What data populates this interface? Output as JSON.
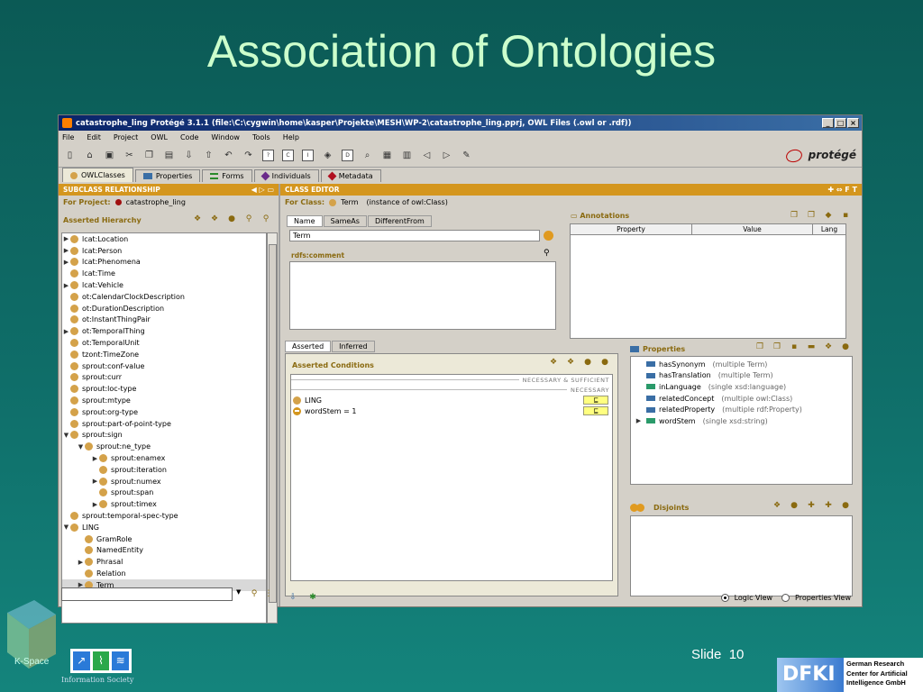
{
  "slide": {
    "title": "Association of Ontologies",
    "footer_slide_label": "Slide",
    "footer_slide_number": "10",
    "left_logo_text": "K-Space",
    "info_society_text": "Information Society",
    "dfki_line1": "German Research",
    "dfki_line2": "Center for Artificial",
    "dfki_line3": "Intelligence GmbH"
  },
  "window": {
    "title": "catastrophe_ling  Protégé 3.1.1     (file:\\C:\\cygwin\\home\\kasper\\Projekte\\MESH\\WP-2\\catastrophe_ling.pprj, OWL Files (.owl or .rdf))",
    "menu": [
      "File",
      "Edit",
      "Project",
      "OWL",
      "Code",
      "Window",
      "Tools",
      "Help"
    ],
    "brand": "protégé",
    "tabs": [
      {
        "label": "OWLClasses",
        "icon": "class-dot"
      },
      {
        "label": "Properties",
        "icon": "property-bar"
      },
      {
        "label": "Forms",
        "icon": "forms-icon"
      },
      {
        "label": "Individuals",
        "icon": "individual-diamond"
      },
      {
        "label": "Metadata",
        "icon": "metadata-diamond"
      }
    ]
  },
  "left_panel": {
    "header": "SUBCLASS RELATIONSHIP",
    "for_project_label": "For Project:",
    "project_name": "catastrophe_ling",
    "hierarchy_label": "Asserted Hierarchy",
    "tree": [
      {
        "label": "lcat:Location",
        "arrow": "▶",
        "indent": 0
      },
      {
        "label": "lcat:Person",
        "arrow": "▶",
        "indent": 0
      },
      {
        "label": "lcat:Phenomena",
        "arrow": "▶",
        "indent": 0
      },
      {
        "label": "lcat:Time",
        "arrow": "",
        "indent": 0
      },
      {
        "label": "lcat:Vehicle",
        "arrow": "▶",
        "indent": 0
      },
      {
        "label": "ot:CalendarClockDescription",
        "arrow": "",
        "indent": 0
      },
      {
        "label": "ot:DurationDescription",
        "arrow": "",
        "indent": 0
      },
      {
        "label": "ot:InstantThingPair",
        "arrow": "",
        "indent": 0
      },
      {
        "label": "ot:TemporalThing",
        "arrow": "▶",
        "indent": 0
      },
      {
        "label": "ot:TemporalUnit",
        "arrow": "",
        "indent": 0
      },
      {
        "label": "tzont:TimeZone",
        "arrow": "",
        "indent": 0
      },
      {
        "label": "sprout:conf-value",
        "arrow": "",
        "indent": 0
      },
      {
        "label": "sprout:curr",
        "arrow": "",
        "indent": 0
      },
      {
        "label": "sprout:loc-type",
        "arrow": "",
        "indent": 0
      },
      {
        "label": "sprout:mtype",
        "arrow": "",
        "indent": 0
      },
      {
        "label": "sprout:org-type",
        "arrow": "",
        "indent": 0
      },
      {
        "label": "sprout:part-of-point-type",
        "arrow": "",
        "indent": 0
      },
      {
        "label": "sprout:sign",
        "arrow": "▼",
        "indent": 0
      },
      {
        "label": "sprout:ne_type",
        "arrow": "▼",
        "indent": 1
      },
      {
        "label": "sprout:enamex",
        "arrow": "▶",
        "indent": 2
      },
      {
        "label": "sprout:iteration",
        "arrow": "",
        "indent": 2
      },
      {
        "label": "sprout:numex",
        "arrow": "▶",
        "indent": 2
      },
      {
        "label": "sprout:span",
        "arrow": "",
        "indent": 2
      },
      {
        "label": "sprout:timex",
        "arrow": "▶",
        "indent": 2
      },
      {
        "label": "sprout:temporal-spec-type",
        "arrow": "",
        "indent": 0
      },
      {
        "label": "LING",
        "arrow": "▼",
        "indent": 0
      },
      {
        "label": "GramRole",
        "arrow": "",
        "indent": 1
      },
      {
        "label": "NamedEntity",
        "arrow": "",
        "indent": 1
      },
      {
        "label": "Phrasal",
        "arrow": "▶",
        "indent": 1
      },
      {
        "label": "Relation",
        "arrow": "",
        "indent": 1
      },
      {
        "label": "Term",
        "arrow": "▶",
        "indent": 1
      }
    ]
  },
  "class_editor": {
    "header": "CLASS EDITOR",
    "for_class_label": "For Class:",
    "class_name": "Term",
    "instance_of": "(instance of owl:Class)",
    "name_tabs": [
      "Name",
      "SameAs",
      "DifferentFrom"
    ],
    "name_value": "Term",
    "rdfs_comment_label": "rdfs:comment",
    "annotations_label": "Annotations",
    "annotation_columns": [
      "Property",
      "Value",
      "Lang"
    ],
    "condition_tabs": [
      "Asserted",
      "Inferred"
    ],
    "asserted_conditions_label": "Asserted Conditions",
    "nec_suff_label": "NECESSARY & SUFFICIENT",
    "necessary_label": "NECESSARY",
    "conditions": [
      {
        "label": "LING",
        "badge": "⊑"
      },
      {
        "label": "wordStem = 1",
        "badge": "⊑"
      }
    ],
    "properties_label": "Properties",
    "properties": [
      {
        "name": "hasSynonym",
        "detail": "(multiple Term)",
        "arrow": "",
        "color": "blue"
      },
      {
        "name": "hasTranslation",
        "detail": "(multiple Term)",
        "arrow": "",
        "color": "blue"
      },
      {
        "name": "inLanguage",
        "detail": "(single xsd:language)",
        "arrow": "",
        "color": "green"
      },
      {
        "name": "relatedConcept",
        "detail": "(multiple owl:Class)",
        "arrow": "",
        "color": "blue"
      },
      {
        "name": "relatedProperty",
        "detail": "(multiple rdf:Property)",
        "arrow": "",
        "color": "blue"
      },
      {
        "name": "wordStem",
        "detail": "(single xsd:string)",
        "arrow": "▶",
        "color": "green"
      }
    ],
    "disjoints_label": "Disjoints",
    "view_options": [
      "Logic View",
      "Properties View"
    ],
    "selected_view": "Logic View"
  }
}
